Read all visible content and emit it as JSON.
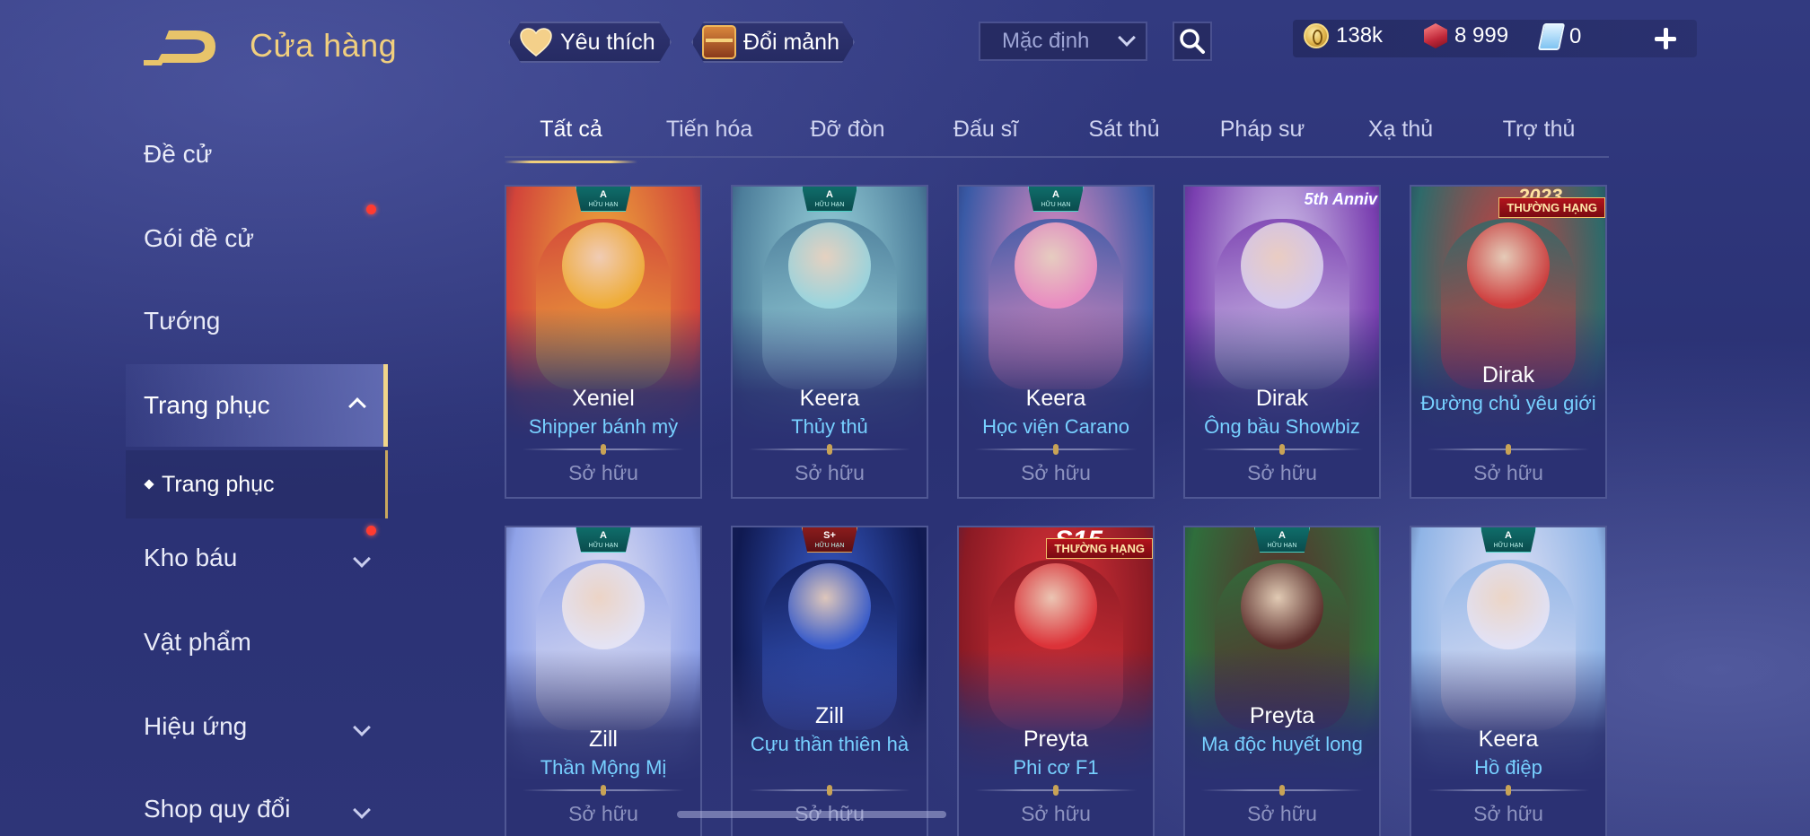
{
  "header": {
    "title": "Cửa hàng",
    "favorite_label": "Yêu thích",
    "shard_label": "Đổi mảnh",
    "sort": {
      "selected": "Mặc định"
    },
    "currencies": {
      "gold": "138k",
      "ruby": "8 999",
      "ticket": "0"
    }
  },
  "sidebar": {
    "items": [
      {
        "label": "Đề cử"
      },
      {
        "label": "Gói đề cử"
      },
      {
        "label": "Tướng"
      },
      {
        "label": "Trang phục"
      },
      {
        "label": "Kho báu"
      },
      {
        "label": "Vật phẩm"
      },
      {
        "label": "Hiệu ứng"
      },
      {
        "label": "Shop quy đổi"
      }
    ],
    "sub_item": "Trang phục"
  },
  "tabs": [
    "Tất cả",
    "Tiến hóa",
    "Đỡ đòn",
    "Đấu sĩ",
    "Sát thủ",
    "Pháp sư",
    "Xạ thủ",
    "Trợ thủ"
  ],
  "owned_label": "Sở hữu",
  "cards": [
    {
      "hero": "Xeniel",
      "skin": "Shipper bánh mỳ",
      "rank": "A",
      "rank_sub": "HỮU HẠN",
      "colors": [
        "#f0b23a",
        "#d2443a"
      ]
    },
    {
      "hero": "Keera",
      "skin": "Thủy thủ",
      "rank": "A",
      "rank_sub": "HỮU HẠN",
      "colors": [
        "#9fd8e0",
        "#4c7d9a"
      ]
    },
    {
      "hero": "Keera",
      "skin": "Học viện Carano",
      "rank": "A",
      "rank_sub": "HỮU HẠN",
      "colors": [
        "#f08fc2",
        "#3a5aa6"
      ]
    },
    {
      "hero": "Dirak",
      "skin": "Ông bầu Showbiz",
      "top_badge": "5th Anniv",
      "colors": [
        "#d9d0f0",
        "#7a3fb0"
      ]
    },
    {
      "hero": "Dirak",
      "skin": "Đường chủ yêu giới",
      "top_badge": "2023",
      "ranked": "THƯỜNG HẠNG",
      "colors": [
        "#d63b3b",
        "#2e6a6a"
      ]
    },
    {
      "hero": "Zill",
      "skin": "Thần Mộng Mị",
      "rank": "A",
      "rank_sub": "HỮU HẠN",
      "colors": [
        "#e8e6f4",
        "#8fa2e8"
      ]
    },
    {
      "hero": "Zill",
      "skin": "Cựu thần thiên hà",
      "rank": "S+",
      "rank_sub": "HỮU HẠN",
      "colors": [
        "#3b5fd0",
        "#101a52"
      ]
    },
    {
      "hero": "Preyta",
      "skin": "Phi cơ F1",
      "top_badge": "S15",
      "ranked": "THƯỜNG HẠNG",
      "colors": [
        "#e0343a",
        "#8a1a24"
      ]
    },
    {
      "hero": "Preyta",
      "skin": "Ma độc huyết long",
      "rank": "A",
      "rank_sub": "HỮU HẠN",
      "colors": [
        "#5e2a2a",
        "#2f6e3c"
      ]
    },
    {
      "hero": "Keera",
      "skin": "Hồ điệp",
      "rank": "A",
      "rank_sub": "HỮU HẠN",
      "colors": [
        "#e6e4f6",
        "#8fb4e6"
      ]
    }
  ]
}
